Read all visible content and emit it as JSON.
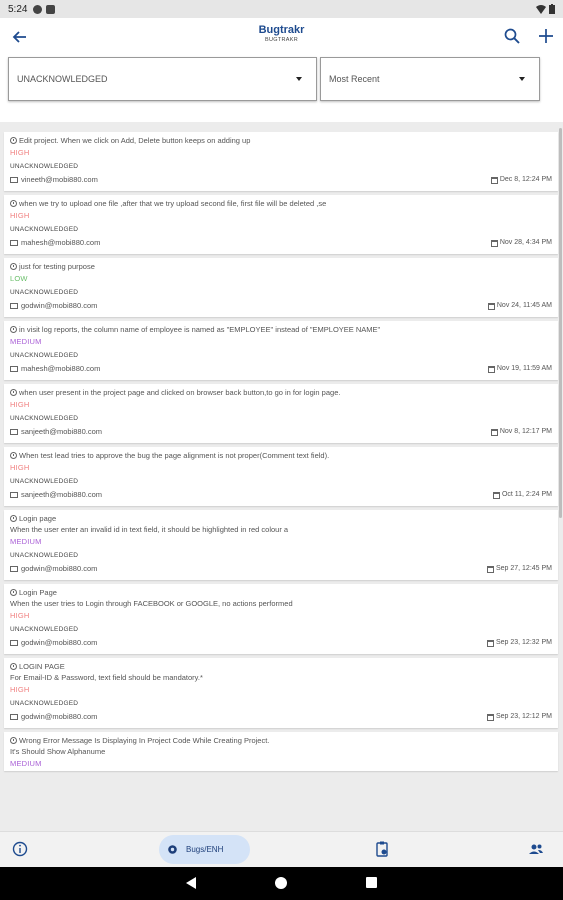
{
  "status_bar": {
    "time": "5:24"
  },
  "app_bar": {
    "title": "Bugtrakr",
    "subtitle": "BUGTRAKR"
  },
  "filters": {
    "status_value": "UNACKNOWLEDGED",
    "sort_value": "Most Recent"
  },
  "colors": {
    "high": "#f08080",
    "low": "#6bbf6b",
    "medium": "#a95fd6",
    "title": "#1e4b8f",
    "nav_active_bg": "#d4e3f7"
  },
  "bugs": [
    {
      "lines": [
        "Edit project. When we click on Add, Delete button keeps on adding up"
      ],
      "priority": "HIGH",
      "status": "UNACKNOWLEDGED",
      "email": "vineeth@mobi880.com",
      "date": "Dec 8, 12:24 PM"
    },
    {
      "lines": [
        "when we try to upload one file ,after that we try upload second file, first file will be deleted ,se"
      ],
      "priority": "HIGH",
      "status": "UNACKNOWLEDGED",
      "email": "mahesh@mobi880.com",
      "date": "Nov 28, 4:34 PM"
    },
    {
      "lines": [
        "just for testing purpose"
      ],
      "priority": "LOW",
      "status": "UNACKNOWLEDGED",
      "email": "godwin@mobi880.com",
      "date": "Nov 24, 11:45 AM"
    },
    {
      "lines": [
        "in visit log reports, the column name of employee is named as \"EMPLOYEE\" instead of \"EMPLOYEE NAME\""
      ],
      "priority": "MEDIUM",
      "status": "UNACKNOWLEDGED",
      "email": "mahesh@mobi880.com",
      "date": "Nov 19, 11:59 AM"
    },
    {
      "lines": [
        "when user present in the project page and clicked on browser back button,to go in for login page."
      ],
      "priority": "HIGH",
      "status": "UNACKNOWLEDGED",
      "email": "sanjeeth@mobi880.com",
      "date": "Nov 8, 12:17 PM"
    },
    {
      "lines": [
        "When test lead tries to approve the bug the page alignment is not proper(Comment text field)."
      ],
      "priority": "HIGH",
      "status": "UNACKNOWLEDGED",
      "email": "sanjeeth@mobi880.com",
      "date": "Oct 11, 2:24 PM"
    },
    {
      "lines": [
        "Login page",
        "When the user enter an invalid id in text field, it should be highlighted in red colour a"
      ],
      "priority": "MEDIUM",
      "status": "UNACKNOWLEDGED",
      "email": "godwin@mobi880.com",
      "date": "Sep 27, 12:45 PM"
    },
    {
      "lines": [
        "Login Page",
        "When the user tries to Login through FACEBOOK or GOOGLE, no actions performed"
      ],
      "priority": "HIGH",
      "status": "UNACKNOWLEDGED",
      "email": "godwin@mobi880.com",
      "date": "Sep 23, 12:32 PM"
    },
    {
      "lines": [
        "LOGIN PAGE",
        "For Email-ID & Password, text field should be mandatory.*"
      ],
      "priority": "HIGH",
      "status": "UNACKNOWLEDGED",
      "email": "godwin@mobi880.com",
      "date": "Sep 23, 12:12 PM"
    },
    {
      "lines": [
        "Wrong Error Message Is Displaying In Project Code While Creating Project.",
        "It's Should Show Alphanume"
      ],
      "priority": "MEDIUM",
      "status": "",
      "email": "",
      "date": ""
    }
  ],
  "bottom_nav": {
    "bugs_label": "Bugs/ENH"
  }
}
